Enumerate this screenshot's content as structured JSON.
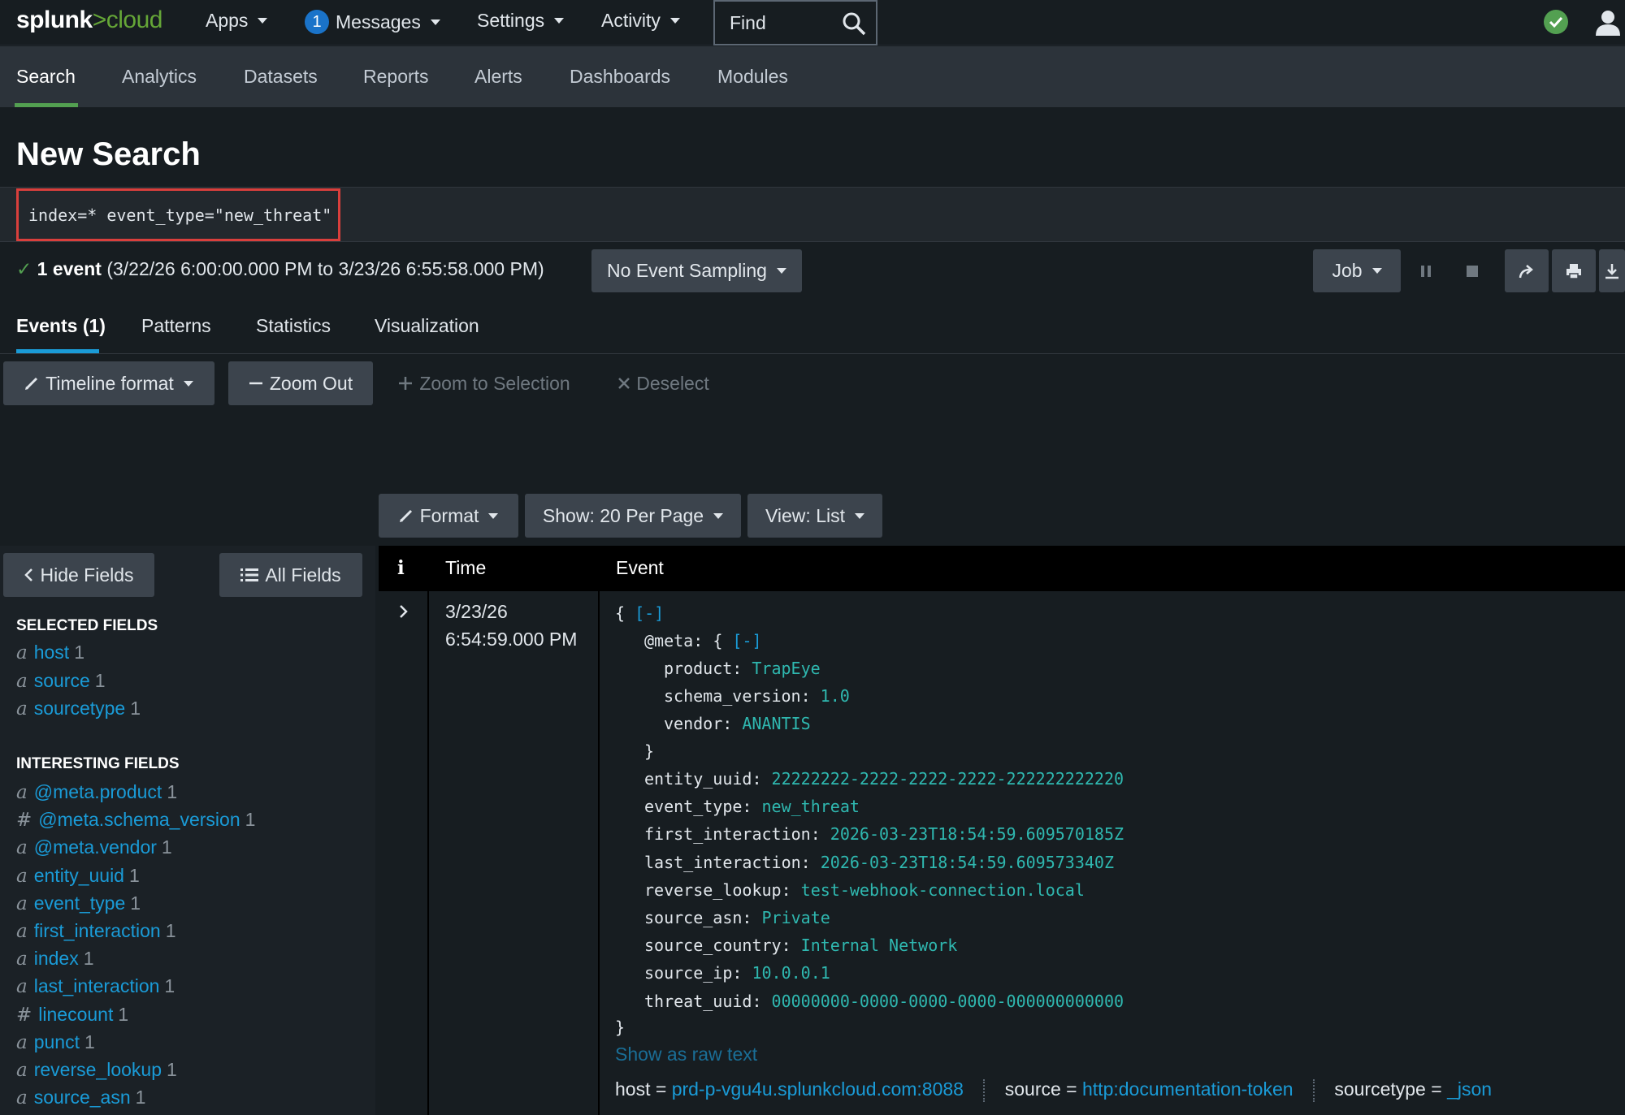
{
  "top": {
    "logo_word": "splunk",
    "logo_gt": ">",
    "logo_cloud": "cloud",
    "apps": "Apps",
    "messages_count": "1",
    "messages": "Messages",
    "settings": "Settings",
    "activity": "Activity",
    "find": "Find"
  },
  "appnav": [
    "Search",
    "Analytics",
    "Datasets",
    "Reports",
    "Alerts",
    "Dashboards",
    "Modules"
  ],
  "page_title": "New Search",
  "query": "index=* event_type=\"new_threat\"",
  "summary": {
    "check": "✓",
    "count": "1 event",
    "range": "(3/22/26 6:00:00.000 PM to 3/23/26 6:55:58.000 PM)"
  },
  "sampling": "No Event Sampling",
  "job": "Job",
  "result_tabs": [
    "Events (1)",
    "Patterns",
    "Statistics",
    "Visualization"
  ],
  "timeline": {
    "format": "Timeline format",
    "zoom_out": "Zoom Out",
    "zoom_sel": "Zoom to Selection",
    "deselect": "Deselect"
  },
  "list_controls": {
    "format": "Format",
    "show": "Show: 20 Per Page",
    "view": "View: List"
  },
  "sidebar": {
    "hide": "Hide Fields",
    "all": "All Fields",
    "selected_head": "SELECTED FIELDS",
    "interesting_head": "INTERESTING FIELDS",
    "selected": [
      {
        "t": "a",
        "n": "host",
        "c": "1"
      },
      {
        "t": "a",
        "n": "source",
        "c": "1"
      },
      {
        "t": "a",
        "n": "sourcetype",
        "c": "1"
      }
    ],
    "interesting": [
      {
        "t": "a",
        "n": "@meta.product",
        "c": "1"
      },
      {
        "t": "#",
        "n": "@meta.schema_version",
        "c": "1"
      },
      {
        "t": "a",
        "n": "@meta.vendor",
        "c": "1"
      },
      {
        "t": "a",
        "n": "entity_uuid",
        "c": "1"
      },
      {
        "t": "a",
        "n": "event_type",
        "c": "1"
      },
      {
        "t": "a",
        "n": "first_interaction",
        "c": "1"
      },
      {
        "t": "a",
        "n": "index",
        "c": "1"
      },
      {
        "t": "a",
        "n": "last_interaction",
        "c": "1"
      },
      {
        "t": "#",
        "n": "linecount",
        "c": "1"
      },
      {
        "t": "a",
        "n": "punct",
        "c": "1"
      },
      {
        "t": "a",
        "n": "reverse_lookup",
        "c": "1"
      },
      {
        "t": "a",
        "n": "source_asn",
        "c": "1"
      }
    ]
  },
  "table": {
    "col_i": "i",
    "col_time": "Time",
    "col_event": "Event",
    "time_date": "3/23/26",
    "time_clock": "6:54:59.000 PM",
    "open": "{",
    "collapse": "[-]",
    "meta_key": "@meta",
    "meta_open": "{",
    "meta_fields": [
      {
        "k": "product",
        "v": "TrapEye"
      },
      {
        "k": "schema_version",
        "v": "1.0"
      },
      {
        "k": "vendor",
        "v": "ANANTIS"
      }
    ],
    "meta_close": "}",
    "fields": [
      {
        "k": "entity_uuid",
        "v": "22222222-2222-2222-2222-222222222220"
      },
      {
        "k": "event_type",
        "v": "new_threat"
      },
      {
        "k": "first_interaction",
        "v": "2026-03-23T18:54:59.609570185Z"
      },
      {
        "k": "last_interaction",
        "v": "2026-03-23T18:54:59.609573340Z"
      },
      {
        "k": "reverse_lookup",
        "v": "test-webhook-connection.local"
      },
      {
        "k": "source_asn",
        "v": "Private"
      },
      {
        "k": "source_country",
        "v": "Internal Network"
      },
      {
        "k": "source_ip",
        "v": "10.0.0.1"
      },
      {
        "k": "threat_uuid",
        "v": "00000000-0000-0000-0000-000000000000"
      }
    ],
    "close": "}",
    "raw": "Show as raw text",
    "host_label": "host =",
    "host": "prd-p-vgu4u.splunkcloud.com:8088",
    "source_label": "source =",
    "source": "http:documentation-token",
    "sourcetype_label": "sourcetype =",
    "sourcetype": "_json"
  },
  "colors": {
    "bg": "#171d21",
    "nav": "#2c333a",
    "accent_green": "#53a051",
    "link_blue": "#1a9bd7",
    "value_teal": "#2fb8b0",
    "highlight_red": "#d93f3c"
  },
  "icons": [
    "search-icon",
    "check-circle-icon",
    "user-icon",
    "pencil-icon",
    "minus-icon",
    "plus-icon",
    "x-icon",
    "chevron-left-icon",
    "list-icon",
    "chevron-right-icon",
    "pause-icon",
    "stop-icon",
    "share-icon",
    "print-icon",
    "download-icon"
  ]
}
